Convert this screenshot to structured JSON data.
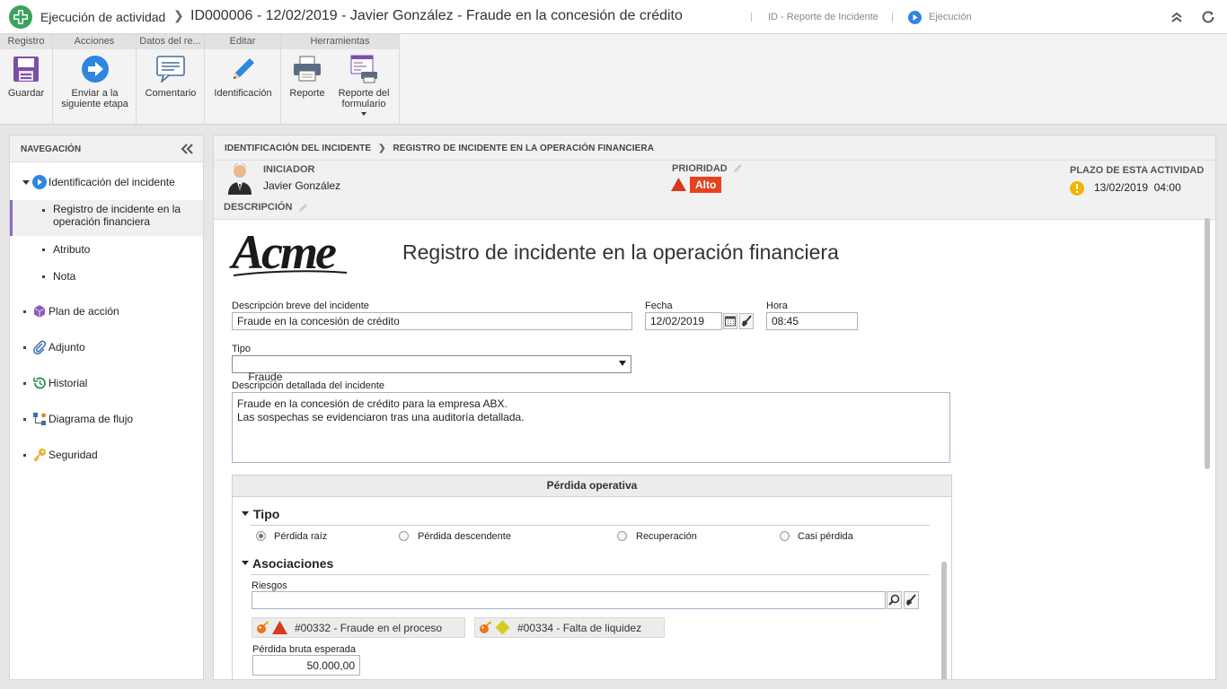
{
  "titlebar": {
    "activity": "Ejecución de actividad",
    "record": "ID000006 - 12/02/2019 - Javier González - Fraude en la concesión de crédito",
    "form_link": "ID - Reporte de Incidente",
    "status": "Ejecución"
  },
  "ribbon": {
    "groups": [
      "Registro",
      "Acciones",
      "Datos del re...",
      "Editar",
      "Herramientas"
    ],
    "buttons": {
      "save": "Guardar",
      "send": "Enviar a la siguiente etapa",
      "comment": "Comentario",
      "identification": "Identificación",
      "report": "Reporte",
      "form_report": "Reporte del formulario"
    }
  },
  "nav": {
    "header": "NAVEGACIÓN",
    "items": [
      {
        "label": "Identificación del incidente"
      },
      {
        "label": "Registro de incidente en la operación financiera"
      },
      {
        "label": "Atributo"
      },
      {
        "label": "Nota"
      },
      {
        "label": "Plan de acción"
      },
      {
        "label": "Adjunto"
      },
      {
        "label": "Historial"
      },
      {
        "label": "Diagrama de flujo"
      },
      {
        "label": "Seguridad"
      }
    ]
  },
  "breadcrumb": {
    "parent": "IDENTIFICACIÓN DEL INCIDENTE",
    "current": "REGISTRO DE INCIDENTE EN LA OPERACIÓN FINANCIERA"
  },
  "info": {
    "initiator_label": "INICIADOR",
    "initiator": "Javier González",
    "priority_label": "PRIORIDAD",
    "priority": "Alto",
    "deadline_label": "PLAZO DE ESTA ACTIVIDAD",
    "deadline": "13/02/2019  04:00",
    "description_label": "DESCRIPCIÓN"
  },
  "form": {
    "logo_text": "Acme",
    "title": "Registro de incidente en la operación financiera",
    "short_desc_label": "Descripción breve del incidente",
    "short_desc": "Fraude en la concesión de crédito",
    "date_label": "Fecha",
    "date": "12/02/2019",
    "time_label": "Hora",
    "time": "08:45",
    "type_label": "Tipo",
    "type": "Fraude",
    "detail_label": "Descripción detallada del incidente",
    "detail": "Fraude en la concesión de crédito para la empresa ABX.\nLas sospechas se evidenciaron tras una auditoría detallada.",
    "loss_section": "Pérdida operativa",
    "tipo_section": "Tipo",
    "radios": [
      "Pérdida raíz",
      "Pérdida descendente",
      "Recuperación",
      "Casi pérdida"
    ],
    "radio_selected": "Pérdida raíz",
    "assoc_section": "Asociaciones",
    "risks_label": "Riesgos",
    "risks": [
      "#00332 - Fraude en el proceso",
      "#00334 - Falta de liquidez"
    ],
    "gross_loss_label": "Pérdida bruta esperada",
    "gross_loss": "50.000,00"
  },
  "colors": {
    "accent": "#2e86de",
    "priority_high": "#e8411f",
    "nav_selected": "#8e6bbf",
    "logo_green": "#3aa35c"
  }
}
